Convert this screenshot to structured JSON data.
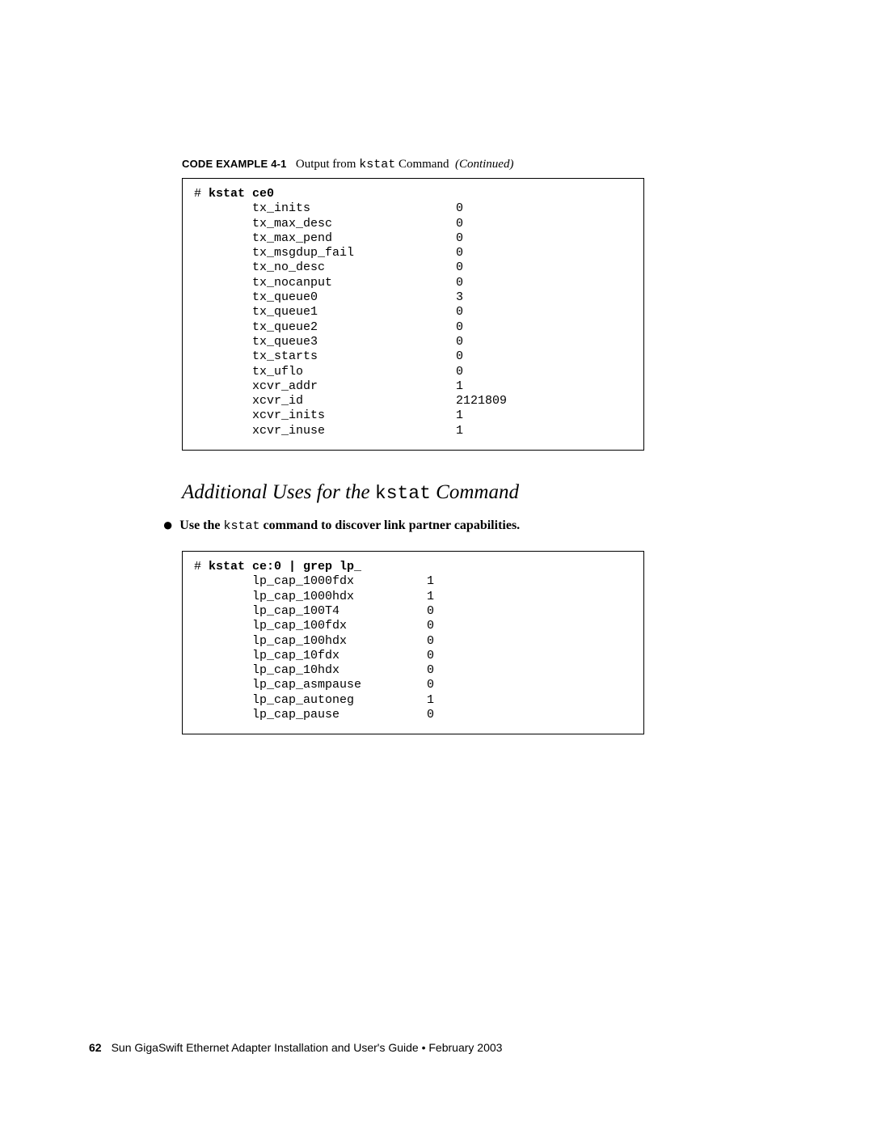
{
  "caption": {
    "label": "CODE EXAMPLE 4-1",
    "lead": "Output from ",
    "mono": "kstat",
    "tail": " Command ",
    "cont": "(Continued)"
  },
  "code1": {
    "prompt": "# ",
    "cmd": "kstat ce0",
    "rows": [
      {
        "k": "tx_inits",
        "v": "0"
      },
      {
        "k": "tx_max_desc",
        "v": "0"
      },
      {
        "k": "tx_max_pend",
        "v": "0"
      },
      {
        "k": "tx_msgdup_fail",
        "v": "0"
      },
      {
        "k": "tx_no_desc",
        "v": "0"
      },
      {
        "k": "tx_nocanput",
        "v": "0"
      },
      {
        "k": "tx_queue0",
        "v": "3"
      },
      {
        "k": "tx_queue1",
        "v": "0"
      },
      {
        "k": "tx_queue2",
        "v": "0"
      },
      {
        "k": "tx_queue3",
        "v": "0"
      },
      {
        "k": "tx_starts",
        "v": "0"
      },
      {
        "k": "tx_uflo",
        "v": "0"
      },
      {
        "k": "xcvr_addr",
        "v": "1"
      },
      {
        "k": "xcvr_id",
        "v": "2121809"
      },
      {
        "k": "xcvr_inits",
        "v": "1"
      },
      {
        "k": "xcvr_inuse",
        "v": "1"
      }
    ]
  },
  "section": {
    "lead": "Additional Uses for the ",
    "mono": "kstat",
    "tail": " Command"
  },
  "bullet": {
    "lead": "Use the ",
    "mono": "kstat",
    "tail": " command to discover link partner capabilities."
  },
  "code2": {
    "prompt": "# ",
    "cmd": "kstat ce:0 | grep lp_",
    "rows": [
      {
        "k": "lp_cap_1000fdx",
        "v": "1"
      },
      {
        "k": "lp_cap_1000hdx",
        "v": "1"
      },
      {
        "k": "lp_cap_100T4",
        "v": "0"
      },
      {
        "k": "lp_cap_100fdx",
        "v": "0"
      },
      {
        "k": "lp_cap_100hdx",
        "v": "0"
      },
      {
        "k": "lp_cap_10fdx",
        "v": "0"
      },
      {
        "k": "lp_cap_10hdx",
        "v": "0"
      },
      {
        "k": "lp_cap_asmpause",
        "v": "0"
      },
      {
        "k": "lp_cap_autoneg",
        "v": "1"
      },
      {
        "k": "lp_cap_pause",
        "v": "0"
      }
    ]
  },
  "footer": {
    "page": "62",
    "title": "Sun GigaSwift Ethernet Adapter Installation and User's Guide • February 2003"
  }
}
